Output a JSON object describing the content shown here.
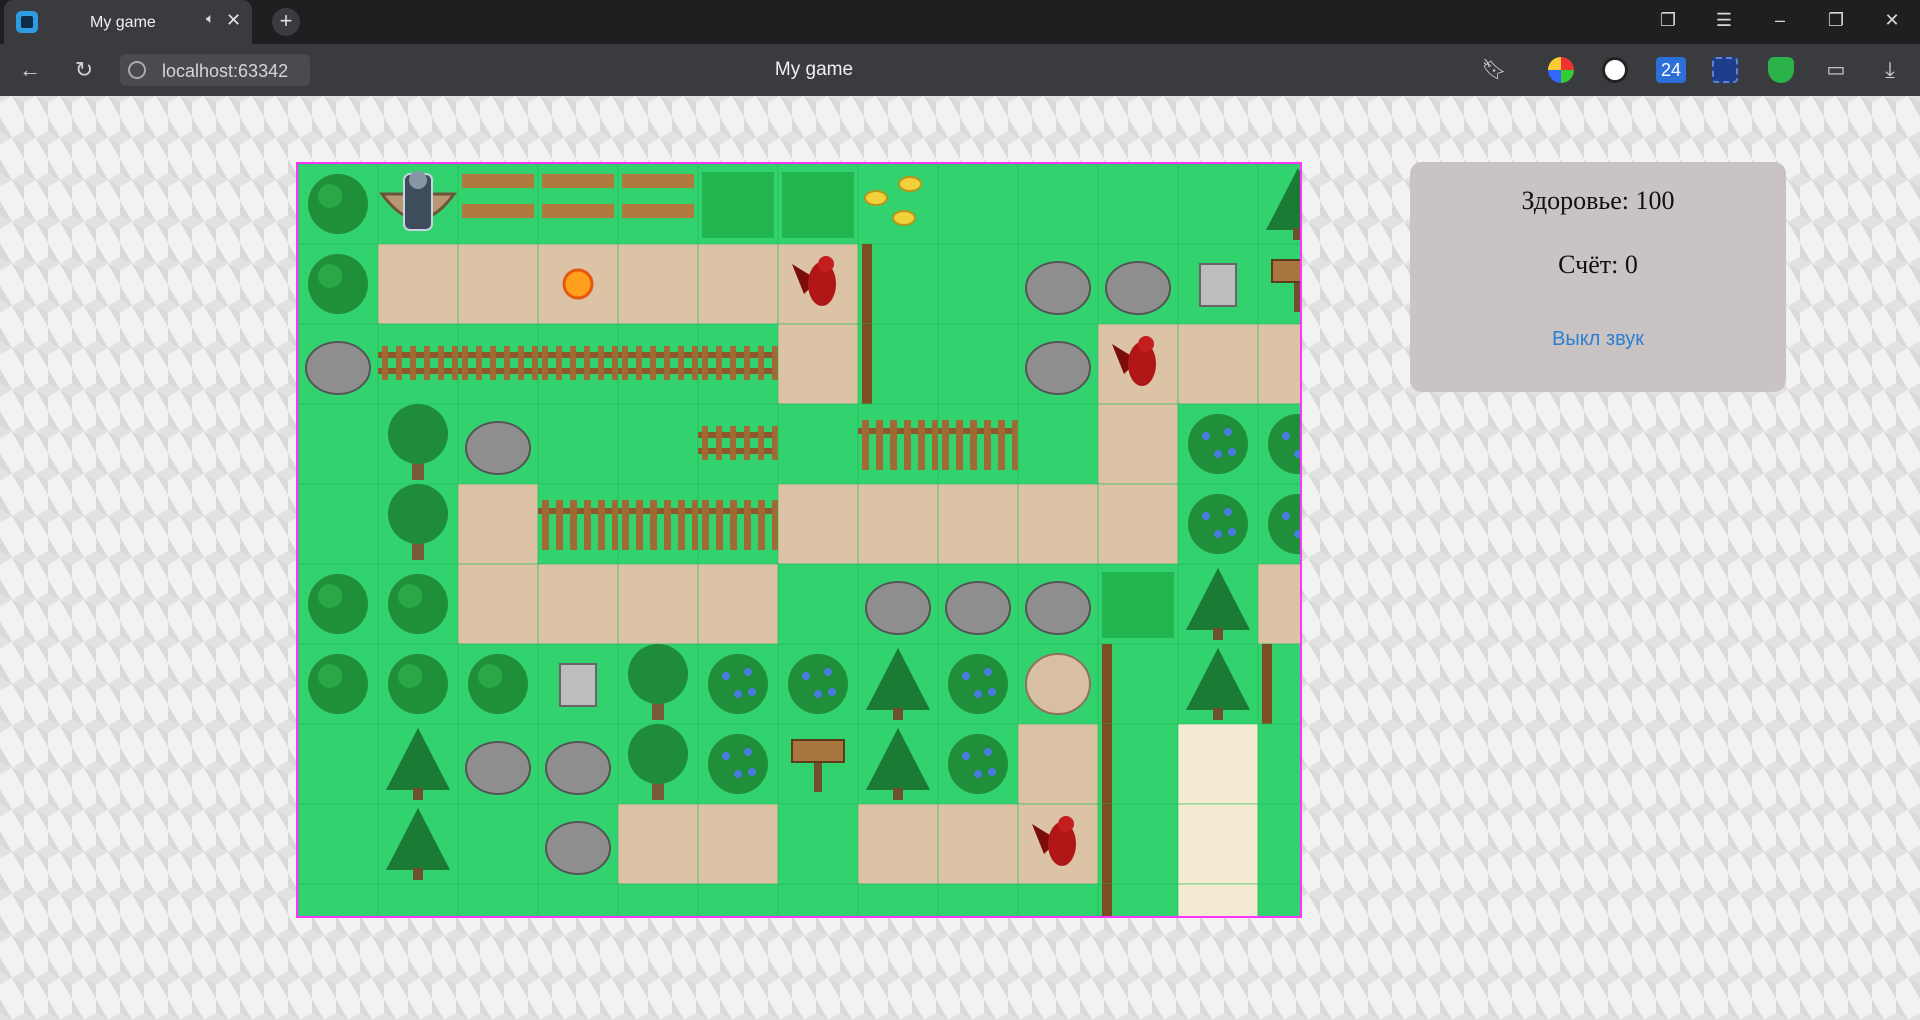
{
  "browser": {
    "tab_title": "My game",
    "url": "localhost:63342",
    "page_title": "My game",
    "extension_badge": "24"
  },
  "hud": {
    "health_label": "Здоровье: 100",
    "score_label": "Счёт: 0",
    "sound_button": "Выкл звук"
  },
  "game": {
    "grid_columns": 13,
    "grid_rows": 10,
    "border_color": "#ff33ff",
    "tiles": [
      "B P N N N T T G G G G G W",
      "B D D D D D M F G R R K S",
      "R H H H H H D F G R D D D",
      "G O R G G H G V V G D E E",
      "G O D V V V D D D D D E E",
      "B B D D D D G R R R T W D",
      "B B B K O E E W E Y X W X",
      "G W R R O E S W E D F C G",
      "G W G R D D G D D D F C G",
      "G G G G G G G G G G F C G"
    ],
    "legend": {
      "G": "grass",
      "D": "dirt-path",
      "B": "bush",
      "O": "oak-tree",
      "W": "pine-tree",
      "R": "rock",
      "E": "berry-bush",
      "H": "horizontal-fence",
      "V": "vertical-fence",
      "N": "bench",
      "T": "tall-grass",
      "K": "well",
      "S": "signpost",
      "Y": "boulder",
      "F": "fence-post-column",
      "C": "sand-path",
      "P": "cliff-edge",
      "X": "fence-corner",
      "M": "dirt-path"
    },
    "entities": [
      {
        "kind": "player-knight",
        "col": 1,
        "row": 0
      },
      {
        "kind": "fireball",
        "col": 3,
        "row": 1
      },
      {
        "kind": "red-demon",
        "col": 6,
        "row": 1
      },
      {
        "kind": "red-demon",
        "col": 10,
        "row": 2
      },
      {
        "kind": "red-demon",
        "col": 9,
        "row": 8
      },
      {
        "kind": "gold-coins",
        "col": 7,
        "row": 0
      }
    ]
  }
}
